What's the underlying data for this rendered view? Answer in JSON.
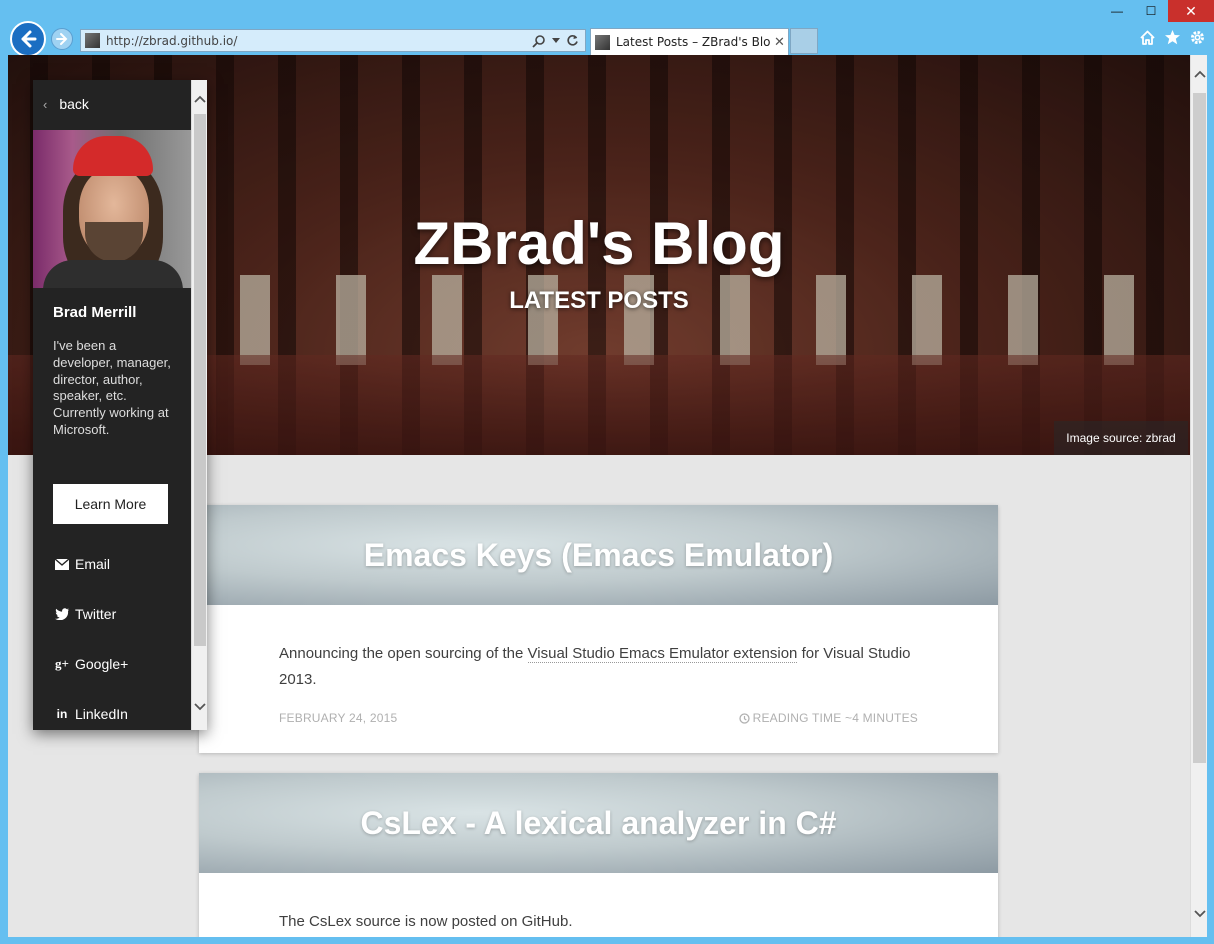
{
  "browser": {
    "url": "http://zbrad.github.io/",
    "tab_title": "Latest Posts – ZBrad's Blog",
    "tab_close": "✕",
    "window_controls": {
      "minimize": "—",
      "maximize": "☐",
      "close": "✕"
    },
    "accent_color": "#65bff0"
  },
  "hero": {
    "title": "ZBrad's Blog",
    "subtitle": "LATEST POSTS",
    "image_source": "Image source: zbrad"
  },
  "sidebar": {
    "back_label": "back",
    "name": "Brad Merrill",
    "bio": "I've been a developer, manager, director, author, speaker, etc. Currently working at Microsoft.",
    "learn_more": "Learn More",
    "links": [
      {
        "label": "Email",
        "icon": "envelope-icon",
        "glyph": "✉"
      },
      {
        "label": "Twitter",
        "icon": "twitter-icon",
        "glyph": "🐦"
      },
      {
        "label": "Google+",
        "icon": "google-plus-icon",
        "glyph": "g+"
      },
      {
        "label": "LinkedIn",
        "icon": "linkedin-icon",
        "glyph": "in"
      }
    ]
  },
  "posts": [
    {
      "title": "Emacs Keys (Emacs Emulator)",
      "excerpt_before": "Announcing the open sourcing of the ",
      "excerpt_link": "Visual Studio Emacs Emulator extension",
      "excerpt_after": " for Visual Studio 2013.",
      "date": "FEBRUARY 24, 2015",
      "reading_time": "READING TIME ~4 MINUTES"
    },
    {
      "title": "CsLex - A lexical analyzer in C#",
      "excerpt_before": "The CsLex source is now posted on GitHub.",
      "excerpt_link": "",
      "excerpt_after": ""
    }
  ]
}
